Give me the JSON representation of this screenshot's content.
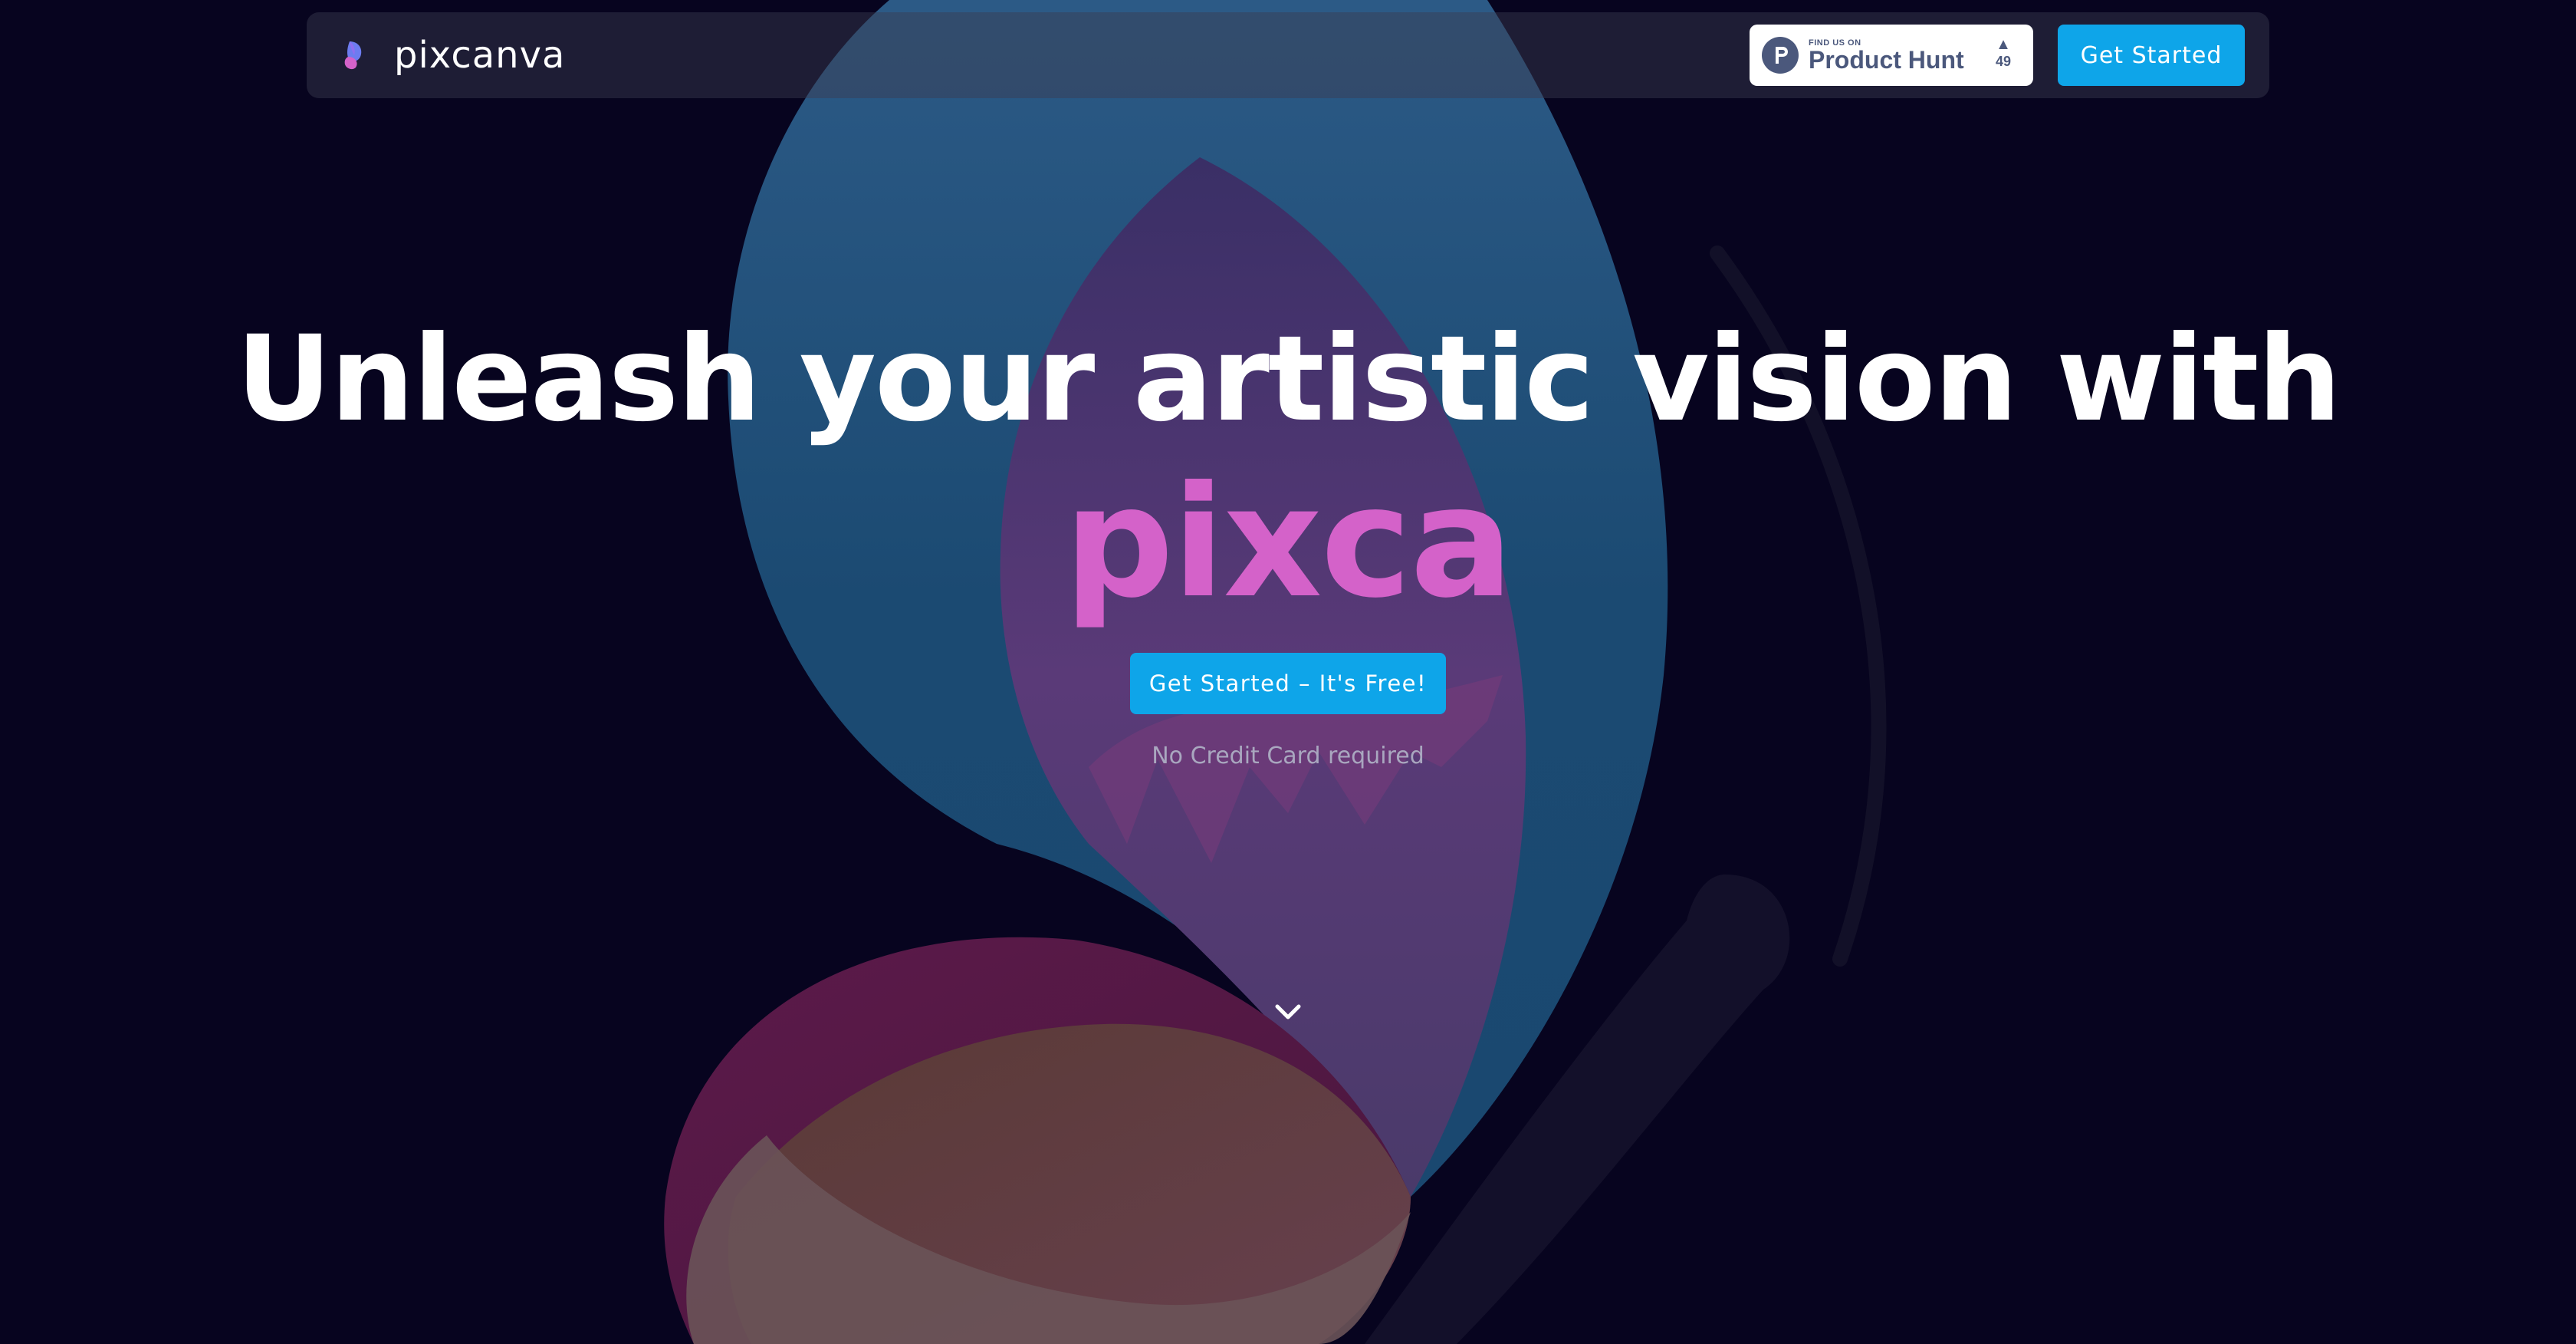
{
  "header": {
    "brand_name": "pixcanva",
    "brand_logo_icon": "butterfly-logo-icon",
    "product_hunt": {
      "small_text": "FIND US ON",
      "big_text": "Product Hunt",
      "upvote_icon": "triangle-up-icon",
      "votes": "49"
    },
    "cta_label": "Get Started"
  },
  "hero": {
    "headline": "Unleash your artistic vision with",
    "accent_word": "pixca",
    "cta_label": "Get Started – It's Free!",
    "note": "No Credit Card required",
    "scroll_icon": "chevron-down-icon"
  },
  "colors": {
    "background": "#07041f",
    "accent_pink": "#d462c9",
    "button_blue": "#0ea5e9",
    "product_hunt_text": "#4b587c"
  }
}
